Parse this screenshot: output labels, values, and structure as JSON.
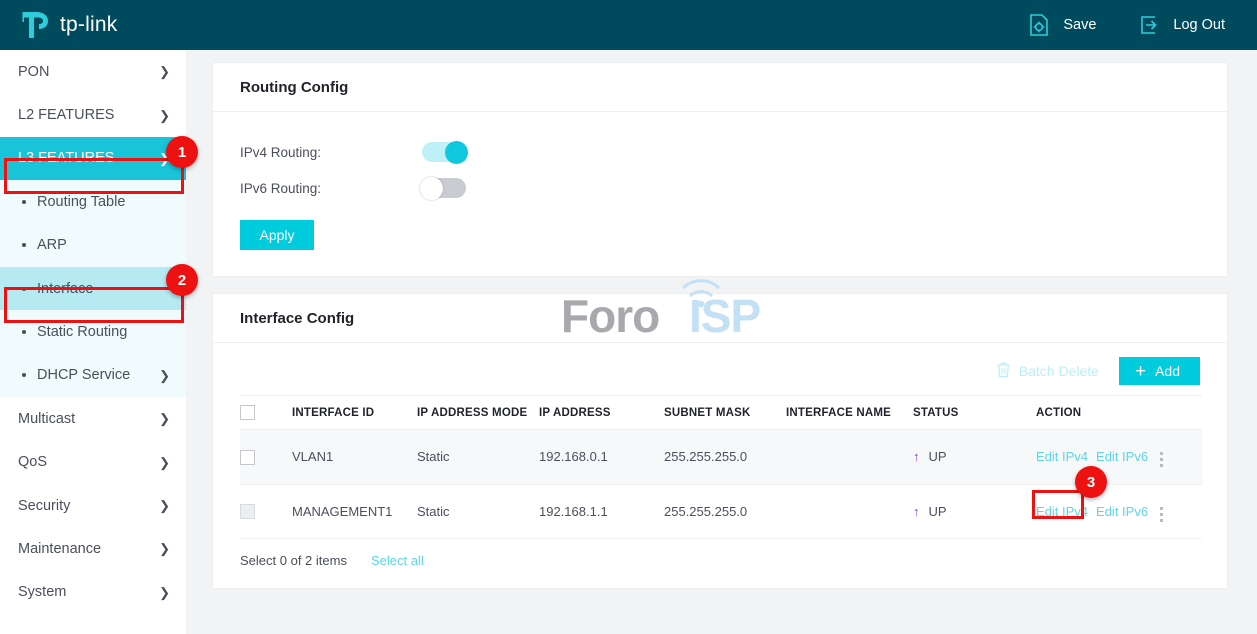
{
  "header": {
    "brand": "tp-link",
    "save_label": "Save",
    "logout_label": "Log Out",
    "save_icon": "document-gear-icon",
    "logout_icon": "logout-arrow-icon",
    "background": "#004a5d"
  },
  "sidebar": {
    "items": [
      {
        "label": "PON",
        "expandable": true,
        "state": "collapsed"
      },
      {
        "label": "L2 FEATURES",
        "expandable": true,
        "state": "collapsed"
      },
      {
        "label": "L3 FEATURES",
        "expandable": true,
        "state": "expanded",
        "active": true
      }
    ],
    "sub_items": [
      {
        "label": "Routing Table",
        "expandable": false,
        "selected": false
      },
      {
        "label": "ARP",
        "expandable": false,
        "selected": false
      },
      {
        "label": "Interface",
        "expandable": false,
        "selected": true
      },
      {
        "label": "Static Routing",
        "expandable": false,
        "selected": false
      },
      {
        "label": "DHCP Service",
        "expandable": true,
        "selected": false
      }
    ],
    "items_after": [
      {
        "label": "Multicast",
        "expandable": true
      },
      {
        "label": "QoS",
        "expandable": true
      },
      {
        "label": "Security",
        "expandable": true
      },
      {
        "label": "Maintenance",
        "expandable": true
      },
      {
        "label": "System",
        "expandable": true
      }
    ]
  },
  "routing_config": {
    "title": "Routing Config",
    "ipv4_label": "IPv4 Routing:",
    "ipv4_enabled": true,
    "ipv6_label": "IPv6 Routing:",
    "ipv6_enabled": false,
    "apply_label": "Apply"
  },
  "interface_config": {
    "title": "Interface Config",
    "watermark_part1": "Foro",
    "watermark_part2": "ISP",
    "batch_delete_label": "Batch Delete",
    "batch_delete_icon": "trash-icon",
    "add_label": "Add",
    "add_icon": "plus-icon",
    "columns": [
      "INTERFACE ID",
      "IP ADDRESS MODE",
      "IP ADDRESS",
      "SUBNET MASK",
      "INTERFACE NAME",
      "STATUS",
      "ACTION"
    ],
    "rows": [
      {
        "interface_id": "VLAN1",
        "ip_address_mode": "Static",
        "ip_address": "192.168.0.1",
        "subnet_mask": "255.255.255.0",
        "interface_name": "",
        "status": "UP",
        "status_icon": "arrow-up-icon",
        "edit_ipv4": "Edit IPv4",
        "edit_ipv6": "Edit IPv6",
        "checkbox_disabled": false
      },
      {
        "interface_id": "MANAGEMENT1",
        "ip_address_mode": "Static",
        "ip_address": "192.168.1.1",
        "subnet_mask": "255.255.255.0",
        "interface_name": "",
        "status": "UP",
        "status_icon": "arrow-up-icon",
        "edit_ipv4": "Edit IPv4",
        "edit_ipv6": "Edit IPv6",
        "checkbox_disabled": true
      }
    ],
    "footer_text": "Select 0 of 2 items",
    "select_all_label": "Select all"
  },
  "annotations": [
    {
      "number": "1",
      "target": "l3-features-menu"
    },
    {
      "number": "2",
      "target": "interface-submenu-item"
    },
    {
      "number": "3",
      "target": "edit-ipv4-link-row2"
    }
  ],
  "colors": {
    "accent": "#00ccdd",
    "header_bg": "#004a5d",
    "annotation": "#ee1111",
    "status_up": "#8b3fd1"
  }
}
